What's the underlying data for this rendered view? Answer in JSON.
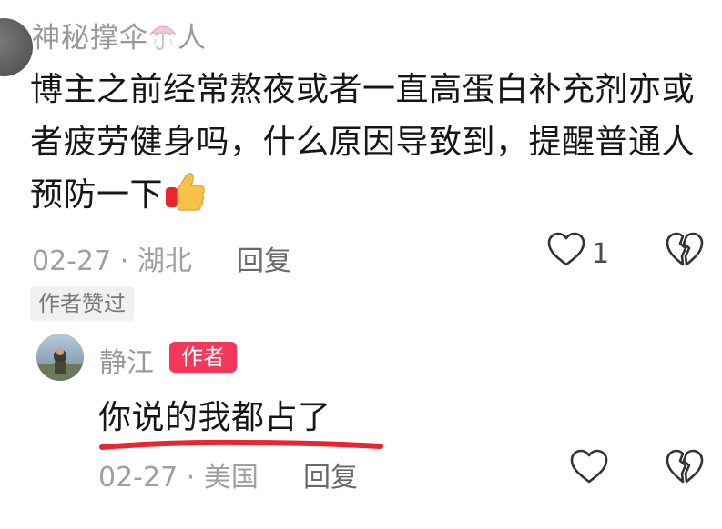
{
  "comment": {
    "username": "神秘撑伞",
    "username_suffix": "人",
    "text": "博主之前经常熬夜或者一直高蛋白补充剂亦或者疲劳健身吗，什么原因导致到，提醒普通人 预防一下",
    "date": "02-27",
    "location": "湖北",
    "reply_label": "回复",
    "like_count": "1",
    "liked_by_author_label": "作者赞过"
  },
  "reply": {
    "username": "静江",
    "author_badge": "作者",
    "text": "你说的我都占了",
    "date": "02-27",
    "location": "美国",
    "reply_label": "回复"
  },
  "meta_separator": "·",
  "icons": [
    "umbrella-emoji-icon",
    "thumbs-up-emoji-icon",
    "heart-icon",
    "broken-heart-icon"
  ],
  "colors": {
    "author_badge": "#f2375a",
    "underline": "#e8262e",
    "meta": "#a0a0a0"
  }
}
